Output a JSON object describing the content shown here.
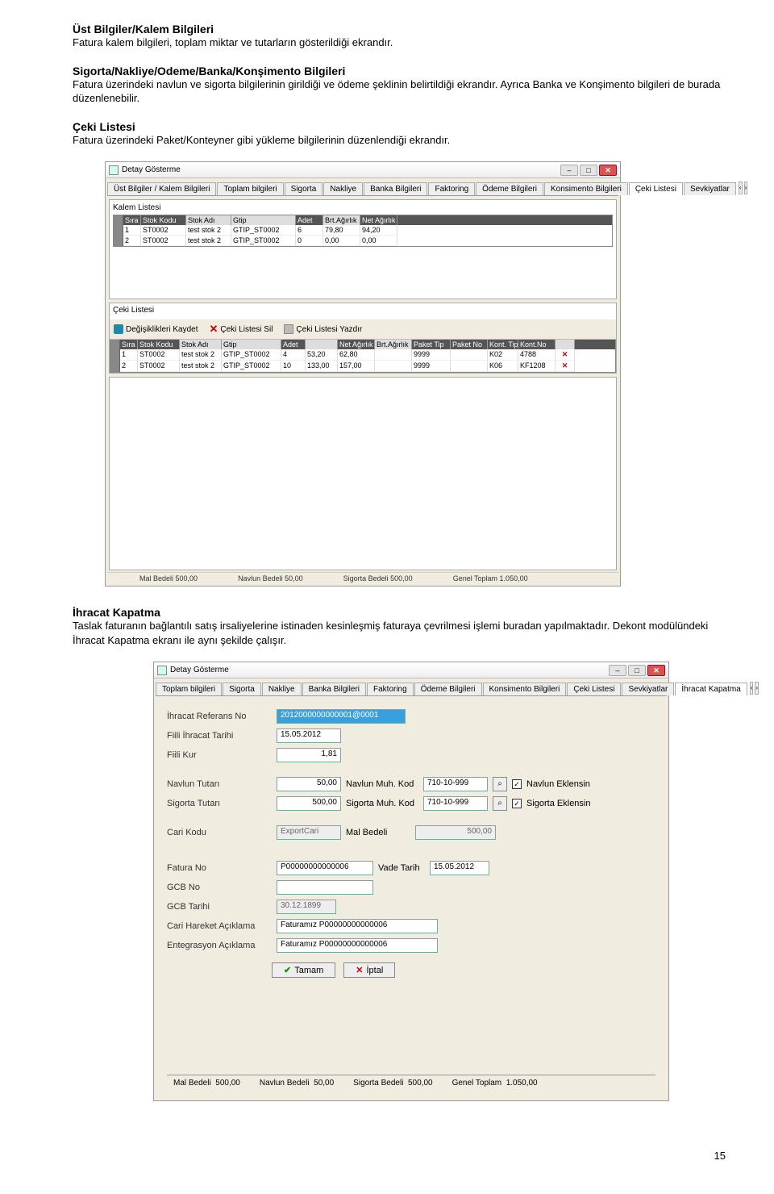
{
  "sections": {
    "s1": {
      "title": "Üst Bilgiler/Kalem Bilgileri",
      "text": "Fatura kalem bilgileri, toplam miktar ve tutarların gösterildiği ekrandır."
    },
    "s2": {
      "title": "Sigorta/Nakliye/Odeme/Banka/Konşimento Bilgileri",
      "text": "Fatura üzerindeki navlun ve sigorta bilgilerinin girildiği ve ödeme şeklinin belirtildiği ekrandır. Ayrıca Banka ve Konşimento bilgileri de burada düzenlenebilir."
    },
    "s3": {
      "title": "Çeki Listesi",
      "text": "Fatura üzerindeki Paket/Konteyner gibi yükleme bilgilerinin düzenlendiği ekrandır."
    },
    "s4": {
      "title": "İhracat Kapatma",
      "text": "Taslak faturanın bağlantılı satış irsaliyelerine istinaden kesinleşmiş faturaya çevrilmesi işlemi buradan yapılmaktadır. Dekont modülündeki İhracat Kapatma ekranı ile aynı şekilde çalışır."
    }
  },
  "page_number": "15",
  "win1": {
    "title": "Detay Gösterme",
    "tabs": [
      "Üst Bilgiler / Kalem Bilgileri",
      "Toplam bilgileri",
      "Sigorta",
      "Nakliye",
      "Banka Bilgileri",
      "Faktoring",
      "Ödeme Bilgileri",
      "Konsimento Bilgileri",
      "Çeki Listesi",
      "Sevkiyatlar"
    ],
    "panel1_title": "Kalem Listesi",
    "grid1_head": [
      "Sıra",
      "Stok Kodu",
      "Stok Adı",
      "Gtip",
      "Adet",
      "Brt.Ağırlık",
      "Net Ağırlık"
    ],
    "grid1_rows": [
      [
        "1",
        "ST0002",
        "test stok 2",
        "GTIP_ST0002",
        "6",
        "79,80",
        "94,20"
      ],
      [
        "2",
        "ST0002",
        "test stok 2",
        "GTIP_ST0002",
        "0",
        "0,00",
        "0,00"
      ]
    ],
    "panel2_title": "Çeki Listesi",
    "toolbar": {
      "save": "Değişiklikleri Kaydet",
      "del": "Çeki Listesi Sil",
      "print": "Çeki Listesi Yazdır"
    },
    "grid2_head": [
      "Sıra",
      "Stok Kodu",
      "Stok Adı",
      "Gtip",
      "Adet",
      "",
      "Net Ağırlık",
      "Brt.Ağırlık",
      "Paket Tip",
      "Paket No",
      "Kont. Tip",
      "Kont.No",
      ""
    ],
    "grid2_rows": [
      [
        "1",
        "ST0002",
        "test stok 2",
        "GTIP_ST0002",
        "4",
        "53,20",
        "62,80",
        "",
        "9999",
        "",
        "K02",
        "4788",
        "✕"
      ],
      [
        "2",
        "ST0002",
        "test stok 2",
        "GTIP_ST0002",
        "10",
        "133,00",
        "157,00",
        "",
        "9999",
        "",
        "K06",
        "KF1208",
        "✕"
      ]
    ],
    "footer": [
      "Mal Bedeli   500,00",
      "Navlun Bedeli  50,00",
      "Sigorta Bedeli   500,00",
      "Genel Toplam   1.050,00"
    ]
  },
  "win2": {
    "title": "Detay Gösterme",
    "tabs": [
      "Toplam bilgileri",
      "Sigorta",
      "Nakliye",
      "Banka Bilgileri",
      "Faktoring",
      "Ödeme Bilgileri",
      "Konsimento Bilgileri",
      "Çeki Listesi",
      "Sevkiyatlar",
      "İhracat Kapatma"
    ],
    "labels": {
      "refno": "İhracat Referans No",
      "fiili_tarih": "Fiili İhracat Tarihi",
      "fiili_kur": "Fiili Kur",
      "navlun_tutari": "Navlun Tutarı",
      "navlun_muh": "Navlun Muh. Kod",
      "navlun_ek": "Navlun Eklensin",
      "sigorta_tutari": "Sigorta Tutarı",
      "sigorta_muh": "Sigorta Muh. Kod",
      "sigorta_ek": "Sigorta Eklensin",
      "cari_kodu": "Cari Kodu",
      "mal_bedeli": "Mal Bedeli",
      "fatura_no": "Fatura No",
      "vade_tarih": "Vade Tarih",
      "gcb_no": "GCB No",
      "gcb_tarihi": "GCB Tarihi",
      "cari_aciklama": "Cari Hareket Açıklama",
      "ent_aciklama": "Entegrasyon Açıklama",
      "tamam": "Tamam",
      "iptal": "İptal"
    },
    "values": {
      "refno": "2012000000000001@0001",
      "fiili_tarih": "15.05.2012",
      "fiili_kur": "1,81",
      "navlun_tutari": "50,00",
      "navlun_muh": "710-10-999",
      "navlun_chk": "✓",
      "sigorta_tutari": "500,00",
      "sigorta_muh": "710-10-999",
      "sigorta_chk": "✓",
      "cari_kodu": "ExportCari",
      "mal_bedeli": "500,00",
      "fatura_no": "P00000000000006",
      "vade_tarih": "15.05.2012",
      "gcb_no": "",
      "gcb_tarihi": "30.12.1899",
      "cari_aciklama": "Faturamız P00000000000006",
      "ent_aciklama": "Faturamız P00000000000006"
    },
    "status": {
      "mal": "Mal Bedeli",
      "mal_v": "500,00",
      "nav": "Navlun Bedeli",
      "nav_v": "50,00",
      "sig": "Sigorta Bedeli",
      "sig_v": "500,00",
      "gen": "Genel Toplam",
      "gen_v": "1.050,00"
    }
  }
}
